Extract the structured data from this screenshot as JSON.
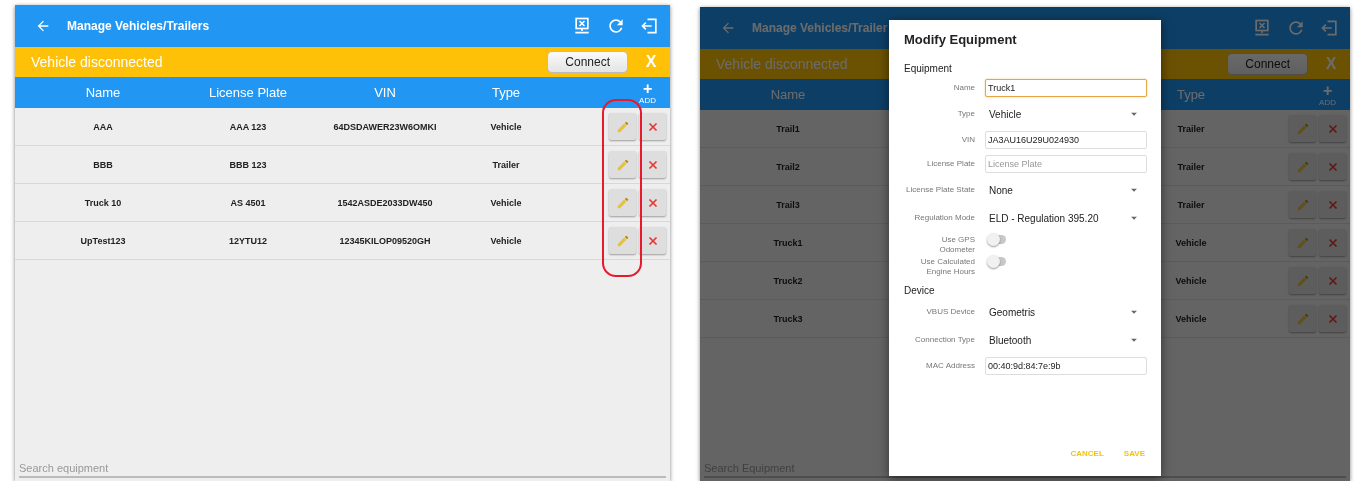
{
  "screens": [
    {
      "title": "Manage Vehicles/Trailers",
      "banner": {
        "text": "Vehicle disconnected",
        "button": "Connect",
        "close": "X"
      },
      "columns": [
        {
          "kind": "name",
          "label": "Name"
        },
        {
          "kind": "plate",
          "label": "License Plate"
        },
        {
          "kind": "vin",
          "label": "VIN"
        },
        {
          "kind": "type",
          "label": "Type"
        }
      ],
      "add": {
        "symbol": "+",
        "label": "ADD"
      },
      "rows": [
        {
          "name": "AAA",
          "plate": "AAA 123",
          "vin": "64DSDAWER23W6OMKI",
          "type": "Vehicle"
        },
        {
          "name": "BBB",
          "plate": "BBB 123",
          "type": "Trailer"
        },
        {
          "name": "Truck 10",
          "plate": "AS 4501",
          "vin": "1542ASDE2033DW450",
          "type": "Vehicle"
        },
        {
          "name": "UpTest123",
          "plate": "12YTU12",
          "vin": "12345KILOP09520GH",
          "type": "Vehicle"
        }
      ],
      "highlight_edit": true,
      "search": {
        "placeholder": "Search equipment"
      }
    },
    {
      "title": "Manage Vehicles/Trailer",
      "banner": {
        "text": "Vehicle disconnected",
        "button": "Connect",
        "close": "X"
      },
      "columns": [
        {
          "kind": "name",
          "label": "Name"
        },
        {
          "kind": "type",
          "label": "Type"
        }
      ],
      "add": {
        "symbol": "+",
        "label": "ADD"
      },
      "rows": [
        {
          "name": "Trail1",
          "type": "Trailer"
        },
        {
          "name": "Trail2",
          "type": "Trailer"
        },
        {
          "name": "Trail3",
          "type": "Trailer"
        },
        {
          "name": "Truck1",
          "type": "Vehicle"
        },
        {
          "name": "Truck2",
          "type": "Vehicle"
        },
        {
          "name": "Truck3",
          "type": "Vehicle"
        }
      ],
      "search": {
        "placeholder": "Search Equipment"
      },
      "dialog": {
        "title": "Modify Equipment",
        "sections": [
          {
            "heading": "Equipment",
            "fields": [
              {
                "kind": "input",
                "label": "Name",
                "value": "Truck1",
                "focused": true
              },
              {
                "kind": "select",
                "label": "Type",
                "value": "Vehicle"
              },
              {
                "kind": "input",
                "label": "VIN",
                "value": "JA3AU16U29U024930",
                "focused": false
              },
              {
                "kind": "input",
                "label": "License Plate",
                "placeholder": "License Plate",
                "focused": false
              },
              {
                "kind": "select",
                "label": "License Plate State",
                "value": "None"
              },
              {
                "kind": "select",
                "label": "Regulation Mode",
                "value": "ELD - Regulation 395.20"
              },
              {
                "kind": "toggle",
                "label": "Use GPS Odometer",
                "on": false
              },
              {
                "kind": "toggle",
                "label": "Use Calculated Engine Hours",
                "on": false
              }
            ]
          },
          {
            "heading": "Device",
            "fields": [
              {
                "kind": "select",
                "label": "VBUS Device",
                "value": "Geometris"
              },
              {
                "kind": "select",
                "label": "Connection Type",
                "value": "Bluetooth"
              },
              {
                "kind": "input",
                "label": "MAC Address",
                "value": "00:40:9d:84:7e:9b",
                "focused": false
              }
            ]
          }
        ],
        "buttons": [
          "CANCEL",
          "SAVE"
        ]
      }
    }
  ]
}
